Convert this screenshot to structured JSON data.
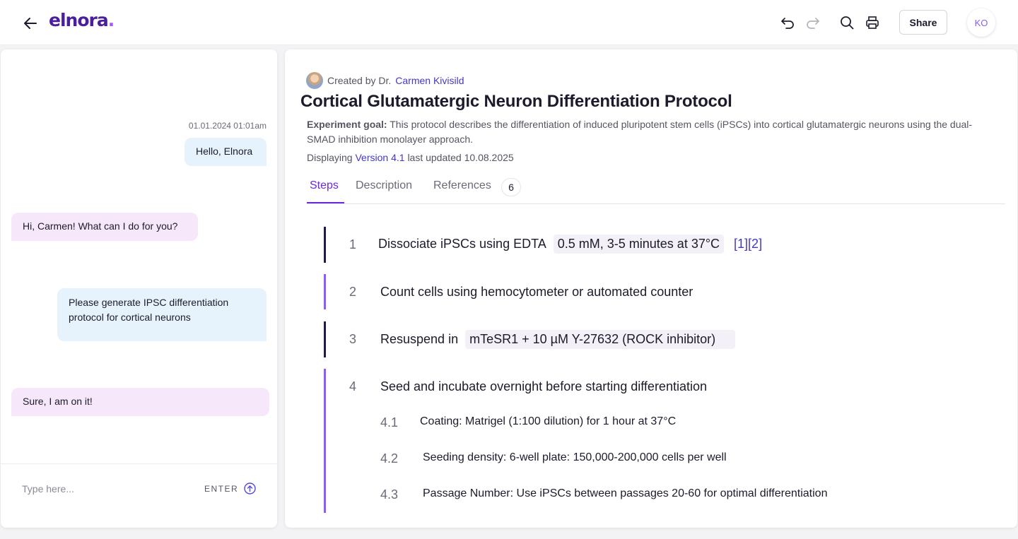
{
  "app": {
    "logo_text": "elnora",
    "logo_dot": "."
  },
  "header": {
    "share_label": "Share",
    "user_initials": "KO",
    "icons": [
      "back-arrow-icon",
      "undo-icon",
      "redo-icon",
      "search-icon",
      "print-icon"
    ]
  },
  "chat": {
    "timestamp": "01.01.2024 01:01am",
    "messages": [
      {
        "role": "user",
        "text": "Hello, Elnora"
      },
      {
        "role": "assistant",
        "text": "Hi, Carmen! What can I do for you?"
      },
      {
        "role": "user",
        "text": "Please generate IPSC differentiation protocol for cortical neurons"
      },
      {
        "role": "assistant",
        "text": "Sure, I am on it!"
      }
    ],
    "input_placeholder": "Type here...",
    "input_value": "",
    "enter_label": "ENTER"
  },
  "protocol": {
    "created_by_label": "Created by Dr.",
    "author": "Carmen Kivisild",
    "title": "Cortical Glutamatergic Neuron Differentiation Protocol",
    "goal_label": "Experiment goal:",
    "goal_text": "This protocol describes the differentiation of induced pluripotent stem cells (iPSCs) into cortical glutamatergic neurons using the dual-SMAD inhibition monolayer approach.",
    "version_prefix": "Displaying",
    "version_link": "Version 4.1",
    "version_suffix": "last updated 10.08.2025",
    "tabs": [
      {
        "label": "Steps",
        "active": true
      },
      {
        "label": "Description",
        "active": false
      },
      {
        "label": "References",
        "active": false,
        "count": "6"
      }
    ],
    "steps": [
      {
        "num": "1",
        "text": "Dissociate iPSCs using EDTA",
        "chip": "0.5 mM, 3-5 minutes at 37°C",
        "citations": "[1][2]"
      },
      {
        "num": "2",
        "text": "Count cells using hemocytometer or automated counter"
      },
      {
        "num": "3",
        "text": "Resuspend in",
        "chip": "mTeSR1 + 10 µM Y-27632 (ROCK inhibitor)"
      },
      {
        "num": "4",
        "text": "Seed and incubate overnight before starting differentiation",
        "substeps": [
          {
            "num": "4.1",
            "text": "Coating: Matrigel (1:100 dilution) for 1 hour at 37°C"
          },
          {
            "num": "4.2",
            "text": "Seeding density: 6-well plate: 150,000-200,000 cells per well"
          },
          {
            "num": "4.3",
            "text": "Passage Number: Use iPSCs between passages 20-60 for optimal differentiation"
          }
        ]
      }
    ],
    "colors": {
      "accent": "#6d28d9",
      "step_bar_dark": "#1e1b4b",
      "step_bar_purple": "#8b5cf6",
      "link": "#4338ca"
    }
  }
}
